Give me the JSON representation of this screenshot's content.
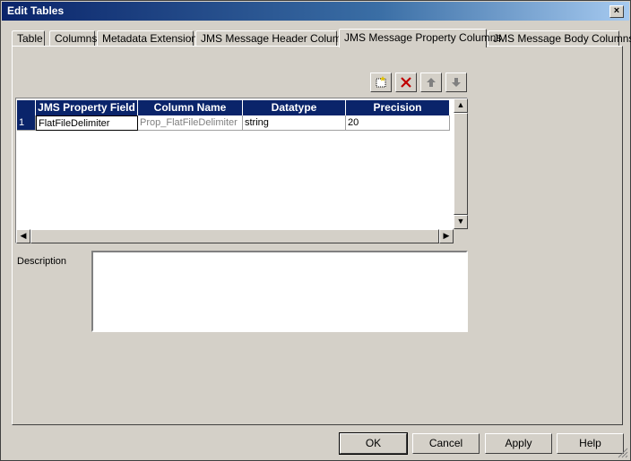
{
  "window": {
    "title": "Edit Tables",
    "close_label": "×"
  },
  "tabs": [
    {
      "label": "Table",
      "active": false
    },
    {
      "label": "Columns",
      "active": false
    },
    {
      "label": "Metadata Extensions",
      "active": false
    },
    {
      "label": "JMS Message Header Columns",
      "active": false
    },
    {
      "label": "JMS Message Property Columns",
      "active": true
    },
    {
      "label": "JMS Message Body Columns",
      "active": false
    }
  ],
  "toolbar": {
    "icons": [
      "new-row-icon",
      "delete-icon",
      "move-up-icon",
      "move-down-icon"
    ]
  },
  "grid": {
    "columns": [
      "JMS Property Field",
      "Column Name",
      "Datatype",
      "Precision"
    ],
    "rows": [
      {
        "num": "1",
        "cells": [
          "FlatFileDelimiter",
          "Prop_FlatFileDelimiter",
          "string",
          "20"
        ]
      }
    ]
  },
  "description": {
    "label": "Description",
    "value": ""
  },
  "buttons": {
    "ok": "OK",
    "cancel": "Cancel",
    "apply": "Apply",
    "help": "Help"
  },
  "colors": {
    "header_bg": "#0a246a",
    "delete_icon": "#c00000"
  }
}
